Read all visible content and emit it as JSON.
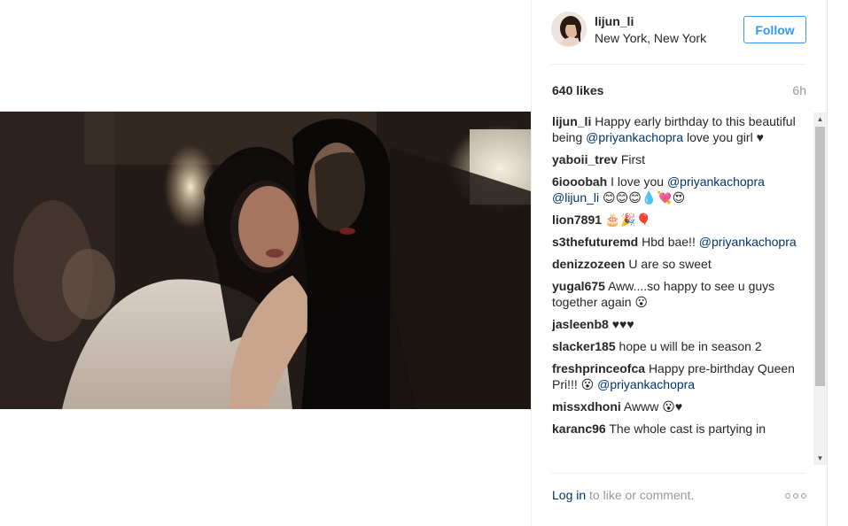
{
  "post": {
    "username": "lijun_li",
    "location": "New York, New York",
    "follow_label": "Follow",
    "likes": "640 likes",
    "time_ago": "6h"
  },
  "comments": [
    {
      "user": "lijun_li",
      "parts": [
        {
          "t": "Happy early birthday to this beautiful being "
        },
        {
          "m": "@priyankachopra"
        },
        {
          "t": " love you girl ♥"
        }
      ]
    },
    {
      "user": "yaboii_trev",
      "parts": [
        {
          "t": "First"
        }
      ]
    },
    {
      "user": "6iooobah",
      "parts": [
        {
          "t": "I love you "
        },
        {
          "m": "@priyankachopra"
        },
        {
          "t": " "
        },
        {
          "m": "@lijun_li"
        },
        {
          "t": " 😊😊😊💧💘😍"
        }
      ]
    },
    {
      "user": "lion7891",
      "parts": [
        {
          "t": "🎂🎉🎈"
        }
      ]
    },
    {
      "user": "s3thefuturemd",
      "parts": [
        {
          "t": "Hbd bae!! "
        },
        {
          "m": "@priyankachopra"
        }
      ]
    },
    {
      "user": "denizzozeen",
      "parts": [
        {
          "t": "U are so sweet"
        }
      ]
    },
    {
      "user": "yugal675",
      "parts": [
        {
          "t": "Aww....so happy to see u guys together again 😮"
        }
      ]
    },
    {
      "user": "jasleenb8",
      "parts": [
        {
          "t": "♥♥♥"
        }
      ]
    },
    {
      "user": "slacker185",
      "parts": [
        {
          "t": "hope u will be in season 2"
        }
      ]
    },
    {
      "user": "freshprinceofca",
      "parts": [
        {
          "t": "Happy pre-birthday Queen Pri!!! 😮 "
        },
        {
          "m": "@priyankachopra"
        }
      ]
    },
    {
      "user": "missxdhoni",
      "parts": [
        {
          "t": "Awww 😮♥"
        }
      ]
    },
    {
      "user": "karanc96",
      "parts": [
        {
          "t": "The whole cast is partying in"
        }
      ]
    }
  ],
  "footer": {
    "login_label": "Log in",
    "rest_label": " to like or comment."
  },
  "icons": {
    "more": "more-options-icon",
    "scroll_up": "scroll-up-arrow-icon",
    "scroll_down": "scroll-down-arrow-icon"
  },
  "colors": {
    "accent": "#3897f0",
    "mention": "#003569",
    "muted": "#999999"
  }
}
